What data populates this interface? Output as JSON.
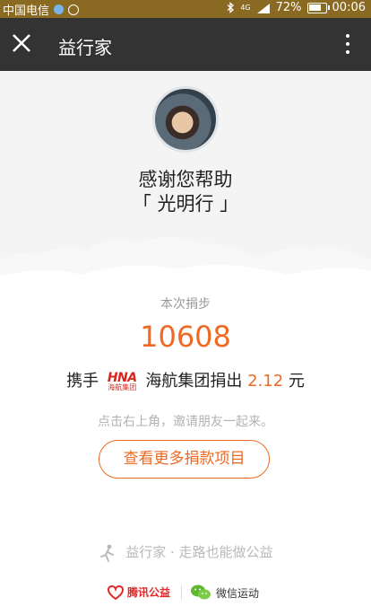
{
  "status_bar": {
    "carrier": "中国电信",
    "network": "4G",
    "battery": "72%",
    "time": "00:06"
  },
  "app_bar": {
    "title": "益行家",
    "close_icon": "close-icon",
    "more_icon": "more-vertical-icon"
  },
  "hero": {
    "thanks_line1": "感谢您帮助",
    "thanks_line2": "「 光明行 」"
  },
  "donation": {
    "steps_label": "本次捐步",
    "steps": "10608",
    "with_prefix": "携手",
    "sponsor_logo_line1": "HNA",
    "sponsor_logo_line2": "海航集团",
    "sponsor_text": "海航集团捐出",
    "amount": "2.12",
    "unit": "元",
    "hint": "点击右上角，邀请朋友一起来。",
    "button_label": "查看更多捐款项目"
  },
  "footer": {
    "slogan": "益行家 · 走路也能做公益",
    "tencent_label": "腾讯公益",
    "wechat_label": "微信运动"
  },
  "colors": {
    "accent": "#ee6a24",
    "app_bar": "#333333",
    "status_bar": "#8a6a22"
  }
}
